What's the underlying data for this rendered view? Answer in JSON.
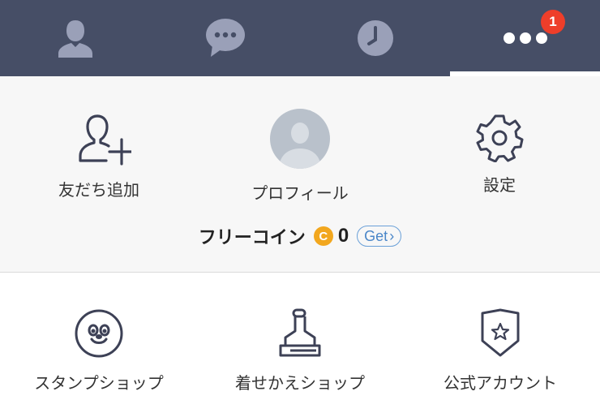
{
  "tabs": [
    {
      "name": "friends",
      "icon": "person-icon"
    },
    {
      "name": "chats",
      "icon": "chat-bubble-icon"
    },
    {
      "name": "timeline",
      "icon": "clock-icon"
    },
    {
      "name": "more",
      "icon": "more-dots-icon",
      "badge": "1",
      "active": true
    }
  ],
  "top_items": {
    "add_friends": {
      "label": "友だち追加",
      "icon": "add-friend-icon"
    },
    "profile": {
      "label": "プロフィール",
      "icon": "avatar"
    },
    "settings": {
      "label": "設定",
      "icon": "gear-icon"
    }
  },
  "coins": {
    "label": "フリーコイン",
    "icon_letter": "C",
    "value": "0",
    "get_label": "Get",
    "get_chevron": "›"
  },
  "bottom_items": {
    "sticker_shop": {
      "label": "スタンプショップ",
      "icon": "smiley-face-icon"
    },
    "theme_shop": {
      "label": "着せかえショップ",
      "icon": "brush-icon"
    },
    "official_accounts": {
      "label": "公式アカウント",
      "icon": "shield-star-icon"
    }
  },
  "colors": {
    "topbar": "#464e66",
    "tab_icon": "#9aa0b8",
    "badge": "#ee3e2a",
    "icon_stroke": "#3d4156",
    "coin": "#f2a71e",
    "get_button": "#4a86c8"
  }
}
